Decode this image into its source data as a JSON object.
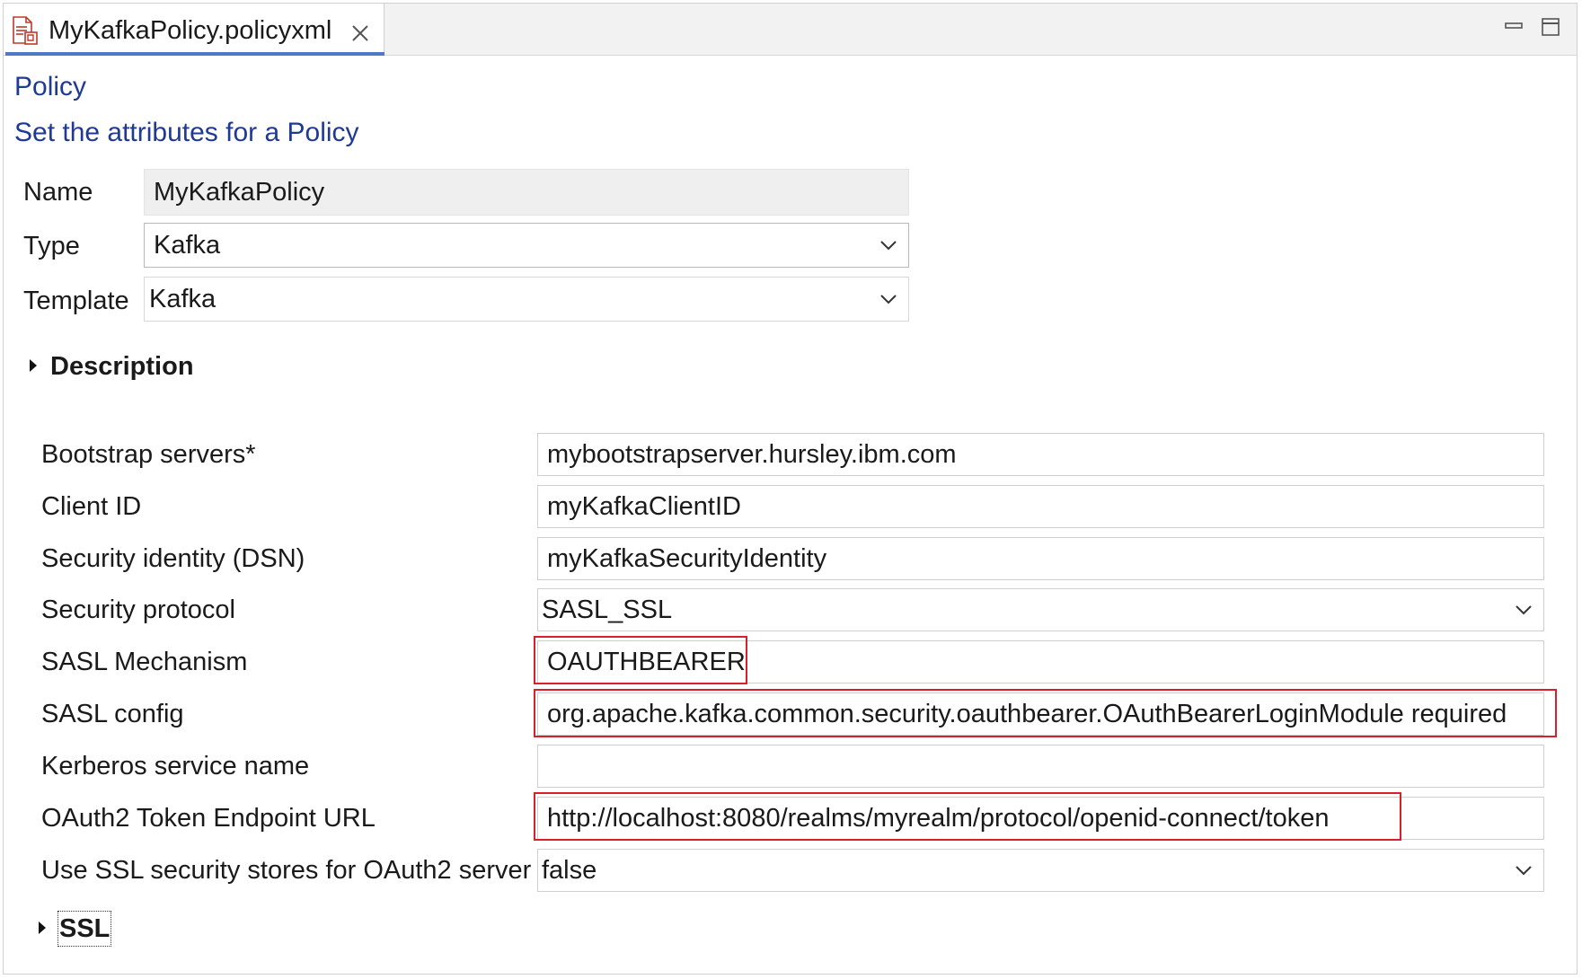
{
  "tab": {
    "title": "MyKafkaPolicy.policyxml",
    "icon": "policy-file-icon",
    "close_icon": "close-icon"
  },
  "window_controls": {
    "minimize_icon": "minimize-icon",
    "maximize_icon": "maximize-icon"
  },
  "header": {
    "title": "Policy",
    "subtitle": "Set the attributes for a Policy"
  },
  "general": {
    "name_label": "Name",
    "name_value": "MyKafkaPolicy",
    "type_label": "Type",
    "type_value": "Kafka",
    "template_label": "Template",
    "template_value": "Kafka"
  },
  "description_section": {
    "title": "Description",
    "expanded": false
  },
  "properties": [
    {
      "label": "Bootstrap servers*",
      "value": "mybootstrapserver.hursley.ibm.com",
      "kind": "text"
    },
    {
      "label": "Client ID",
      "value": "myKafkaClientID",
      "kind": "text"
    },
    {
      "label": "Security identity (DSN)",
      "value": "myKafkaSecurityIdentity",
      "kind": "text"
    },
    {
      "label": "Security protocol",
      "value": "SASL_SSL",
      "kind": "combo"
    },
    {
      "label": "SASL Mechanism",
      "value": "OAUTHBEARER",
      "kind": "text",
      "highlighted": true
    },
    {
      "label": "SASL config",
      "value": "org.apache.kafka.common.security.oauthbearer.OAuthBearerLoginModule required",
      "kind": "text",
      "highlighted": true
    },
    {
      "label": "Kerberos service name",
      "value": "",
      "kind": "text"
    },
    {
      "label": "OAuth2 Token Endpoint URL",
      "value": "http://localhost:8080/realms/myrealm/protocol/openid-connect/token",
      "kind": "text",
      "highlighted": true
    },
    {
      "label": "Use SSL security stores for OAuth2 server",
      "value": "false",
      "kind": "combo"
    }
  ],
  "ssl_section": {
    "title": "SSL",
    "expanded": false
  },
  "colors": {
    "heading": "#1f3a93",
    "highlight": "#d8202a",
    "tab_underline": "#4e79c6"
  }
}
